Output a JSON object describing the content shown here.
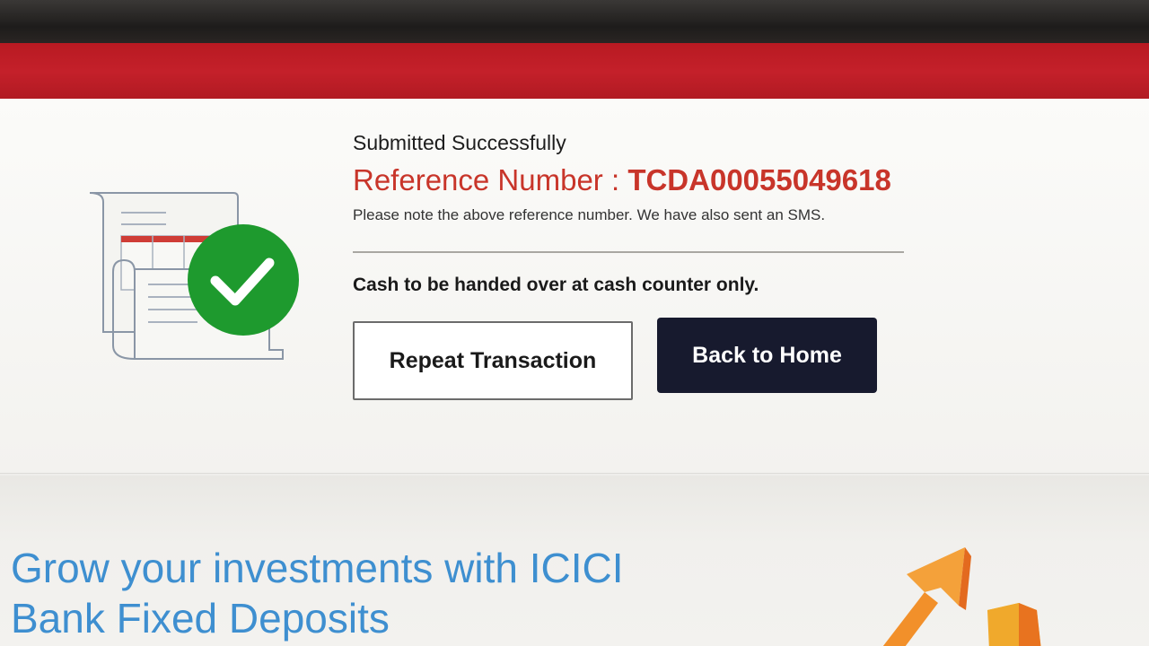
{
  "status": {
    "title": "Submitted Successfully",
    "reference_label": "Reference Number : ",
    "reference_number": "TCDA00055049618",
    "note": "Please note the above reference number. We have also sent an SMS.",
    "cash_note": "Cash to be handed over at cash counter only."
  },
  "actions": {
    "repeat_label": "Repeat Transaction",
    "home_label": "Back to Home"
  },
  "promo": {
    "line1": "Grow your investments with ICICI",
    "line2": "Bank Fixed Deposits"
  },
  "colors": {
    "brand_red": "#c4202a",
    "reference_red": "#c8352a",
    "success_green": "#1e9a2e",
    "home_button": "#171a2e",
    "promo_blue": "#3e8fd0"
  },
  "icons": {
    "illustration": "receipt-document-icon",
    "status": "success-check-icon",
    "promo": "growth-arrow-icon"
  }
}
